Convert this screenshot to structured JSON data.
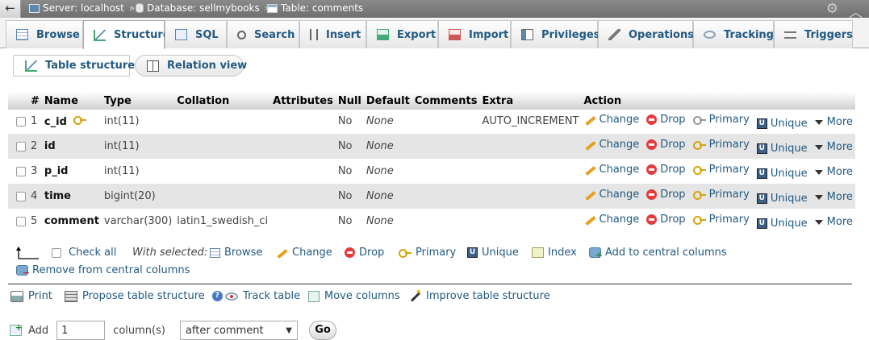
{
  "breadcrumb": {
    "back": "←",
    "server": "Server: localhost",
    "database": "Database: sellmybooks",
    "table": "Table: comments",
    "sep": "»"
  },
  "tabs": [
    {
      "label": "Browse",
      "icon": "browse-icon"
    },
    {
      "label": "Structure",
      "icon": "structure-icon"
    },
    {
      "label": "SQL",
      "icon": "sql-icon"
    },
    {
      "label": "Search",
      "icon": "search-icon"
    },
    {
      "label": "Insert",
      "icon": "insert-icon"
    },
    {
      "label": "Export",
      "icon": "export-icon"
    },
    {
      "label": "Import",
      "icon": "import-icon"
    },
    {
      "label": "Privileges",
      "icon": "privileges-icon"
    },
    {
      "label": "Operations",
      "icon": "operations-icon"
    },
    {
      "label": "Tracking",
      "icon": "tracking-icon"
    },
    {
      "label": "Triggers",
      "icon": "triggers-icon"
    }
  ],
  "subtabs": {
    "table_structure": "Table structure",
    "relation_view": "Relation view"
  },
  "columns": {
    "num": "#",
    "name": "Name",
    "type": "Type",
    "collation": "Collation",
    "attributes": "Attributes",
    "null": "Null",
    "default": "Default",
    "comments": "Comments",
    "extra": "Extra",
    "action": "Action"
  },
  "rows": [
    {
      "num": "1",
      "name": "c_id",
      "type": "int(11)",
      "collation": "",
      "attributes": "",
      "null": "No",
      "default": "None",
      "comments": "",
      "extra": "AUTO_INCREMENT",
      "primary_key": true
    },
    {
      "num": "2",
      "name": "id",
      "type": "int(11)",
      "collation": "",
      "attributes": "",
      "null": "No",
      "default": "None",
      "comments": "",
      "extra": "",
      "primary_key": false
    },
    {
      "num": "3",
      "name": "p_id",
      "type": "int(11)",
      "collation": "",
      "attributes": "",
      "null": "No",
      "default": "None",
      "comments": "",
      "extra": "",
      "primary_key": false
    },
    {
      "num": "4",
      "name": "time",
      "type": "bigint(20)",
      "collation": "",
      "attributes": "",
      "null": "No",
      "default": "None",
      "comments": "",
      "extra": "",
      "primary_key": false
    },
    {
      "num": "5",
      "name": "comment",
      "type": "varchar(300)",
      "collation": "latin1_swedish_ci",
      "attributes": "",
      "null": "No",
      "default": "None",
      "comments": "",
      "extra": "",
      "primary_key": false
    }
  ],
  "actions": {
    "change": "Change",
    "drop": "Drop",
    "primary": "Primary",
    "unique": "Unique",
    "more": "More"
  },
  "bulk": {
    "check_all": "Check all",
    "with_selected": "With selected:",
    "browse": "Browse",
    "change": "Change",
    "drop": "Drop",
    "primary": "Primary",
    "unique": "Unique",
    "index": "Index",
    "add_central": "Add to central columns",
    "remove_central": "Remove from central columns"
  },
  "footer": {
    "print": "Print",
    "propose": "Propose table structure",
    "track": "Track table",
    "move": "Move columns",
    "improve": "Improve table structure"
  },
  "add_columns": {
    "add": "Add",
    "count": "1",
    "columns_label": "column(s)",
    "position": "after comment",
    "go": "Go"
  },
  "colors": {
    "link": "#235a81",
    "row_alt": "#e5e5e5",
    "topbar": "#7d7d7d"
  }
}
